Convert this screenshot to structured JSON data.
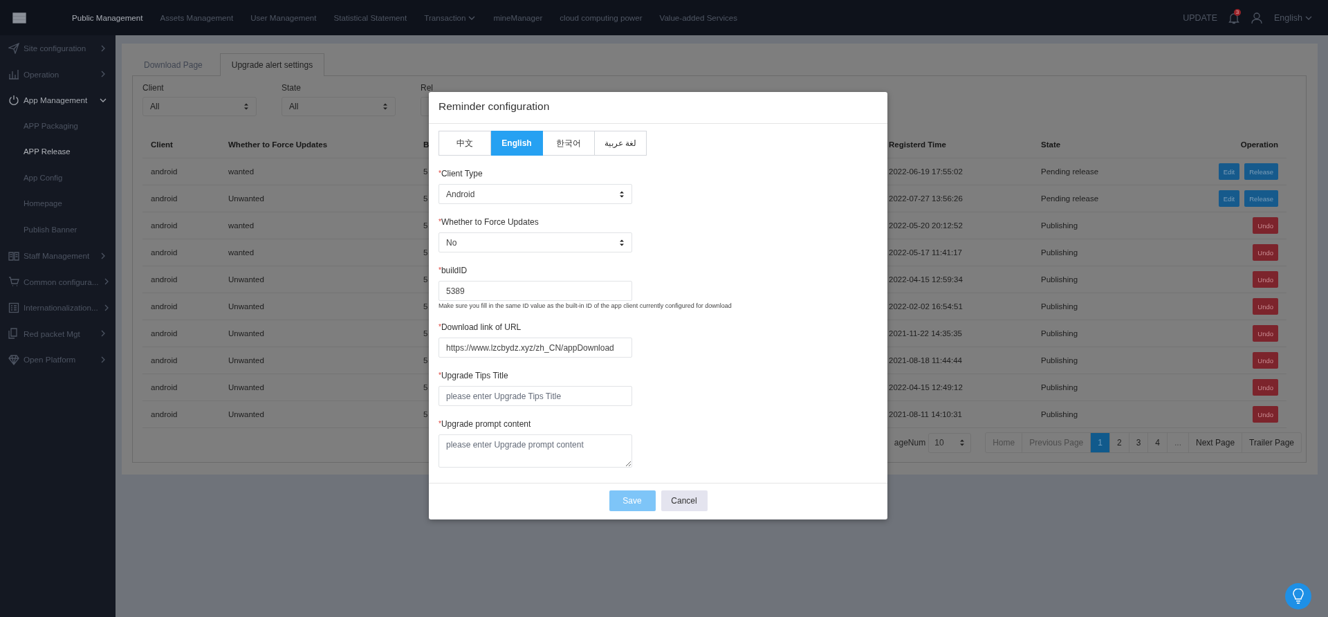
{
  "top_bar": {
    "nav": [
      {
        "label": "Public Management",
        "selected": true,
        "dropdown": false
      },
      {
        "label": "Assets Management",
        "selected": false,
        "dropdown": false
      },
      {
        "label": "User Management",
        "selected": false,
        "dropdown": false
      },
      {
        "label": "Statistical Statement",
        "selected": false,
        "dropdown": false
      },
      {
        "label": "Transaction",
        "selected": false,
        "dropdown": true
      },
      {
        "label": "mineManager",
        "selected": false,
        "dropdown": false
      },
      {
        "label": "cloud computing power",
        "selected": false,
        "dropdown": false
      },
      {
        "label": "Value-added Services",
        "selected": false,
        "dropdown": false
      }
    ],
    "update": "UPDATE",
    "notifications": "3",
    "language": "English"
  },
  "sidebar": {
    "items": [
      {
        "label": "Site configuration",
        "expanded": false
      },
      {
        "label": "Operation",
        "expanded": false
      },
      {
        "label": "App Management",
        "expanded": true,
        "children": [
          {
            "label": "APP Packaging",
            "selected": false
          },
          {
            "label": "APP Release",
            "selected": true
          },
          {
            "label": "App Config",
            "selected": false
          },
          {
            "label": "Homepage",
            "selected": false
          },
          {
            "label": "Publish Banner",
            "selected": false
          }
        ]
      },
      {
        "label": "Staff Management",
        "expanded": false
      },
      {
        "label": "Common configura...",
        "expanded": false
      },
      {
        "label": "Internationalization...",
        "expanded": false
      },
      {
        "label": "Red packet Mgt",
        "expanded": false
      },
      {
        "label": "Open Platform",
        "expanded": false
      }
    ]
  },
  "page_tabs": [
    {
      "label": "Download Page",
      "selected": false
    },
    {
      "label": "Upgrade alert settings",
      "selected": true
    }
  ],
  "filters": [
    {
      "label": "Client",
      "value": "All"
    },
    {
      "label": "State",
      "value": "All"
    },
    {
      "label": "Rel"
    }
  ],
  "table": {
    "columns": [
      "Client",
      "Whether to Force Updates",
      "B",
      "Registerd Time",
      "State",
      "Operation"
    ],
    "rows": [
      {
        "cells": [
          "android",
          "wanted",
          "5",
          "2022-06-19 17:55:02",
          "Pending release"
        ],
        "actions": [
          {
            "label": "Edit",
            "kind": "primary"
          },
          {
            "label": "Release",
            "kind": "primary"
          }
        ]
      },
      {
        "cells": [
          "android",
          "Unwanted",
          "5",
          "2022-07-27 13:56:26",
          "Pending release"
        ],
        "actions": [
          {
            "label": "Edit",
            "kind": "primary"
          },
          {
            "label": "Release",
            "kind": "primary"
          }
        ]
      },
      {
        "cells": [
          "android",
          "wanted",
          "5",
          "2022-05-20 20:12:52",
          "Publishing"
        ],
        "actions": [
          {
            "label": "Undo",
            "kind": "danger"
          }
        ]
      },
      {
        "cells": [
          "android",
          "wanted",
          "5",
          "2022-05-17 11:41:17",
          "Publishing"
        ],
        "actions": [
          {
            "label": "Undo",
            "kind": "danger"
          }
        ]
      },
      {
        "cells": [
          "android",
          "Unwanted",
          "5",
          "2022-04-15 12:59:34",
          "Publishing"
        ],
        "actions": [
          {
            "label": "Undo",
            "kind": "danger"
          }
        ]
      },
      {
        "cells": [
          "android",
          "Unwanted",
          "5",
          "2022-02-02 16:54:51",
          "Publishing"
        ],
        "actions": [
          {
            "label": "Undo",
            "kind": "danger"
          }
        ]
      },
      {
        "cells": [
          "android",
          "Unwanted",
          "5",
          "2021-11-22 14:35:35",
          "Publishing"
        ],
        "actions": [
          {
            "label": "Undo",
            "kind": "danger"
          }
        ]
      },
      {
        "cells": [
          "android",
          "Unwanted",
          "5",
          "2021-08-18 11:44:44",
          "Publishing"
        ],
        "actions": [
          {
            "label": "Undo",
            "kind": "danger"
          }
        ]
      },
      {
        "cells": [
          "android",
          "Unwanted",
          "5",
          "2022-04-15 12:49:12",
          "Publishing"
        ],
        "actions": [
          {
            "label": "Undo",
            "kind": "danger"
          }
        ]
      },
      {
        "cells": [
          "android",
          "Unwanted",
          "5",
          "2021-08-11 14:10:31",
          "Publishing"
        ],
        "actions": [
          {
            "label": "Undo",
            "kind": "danger"
          }
        ]
      }
    ]
  },
  "pagination": {
    "page_size_label": "ageNum",
    "page_size": "10",
    "pages": [
      {
        "label": "Home",
        "selected": false,
        "disabled": true
      },
      {
        "label": "Previous Page",
        "selected": false,
        "disabled": true
      },
      {
        "label": "1",
        "selected": true,
        "disabled": false
      },
      {
        "label": "2",
        "selected": false,
        "disabled": false
      },
      {
        "label": "3",
        "selected": false,
        "disabled": false
      },
      {
        "label": "4",
        "selected": false,
        "disabled": false
      },
      {
        "label": "...",
        "selected": false,
        "disabled": true
      },
      {
        "label": "Next Page",
        "selected": false,
        "disabled": false
      },
      {
        "label": "Trailer Page",
        "selected": false,
        "disabled": false
      }
    ]
  },
  "modal": {
    "title": "Reminder configuration",
    "lang_tabs": [
      {
        "label": "中文",
        "selected": false
      },
      {
        "label": "English",
        "selected": true
      },
      {
        "label": "한국어",
        "selected": false
      },
      {
        "label": "لغة عربية",
        "selected": false
      }
    ],
    "fields": [
      {
        "required_mark": "*",
        "label": "Client Type",
        "kind": "select",
        "value": "Android"
      },
      {
        "required_mark": "*",
        "label": "Whether to Force Updates",
        "kind": "select",
        "value": "No"
      },
      {
        "required_mark": "*",
        "label": "buildID",
        "kind": "input",
        "value": "5389",
        "hint": "Make sure you fill in the same ID value as the built-in ID of the app client currently configured for download"
      },
      {
        "required_mark": "*",
        "label": "Download link of URL",
        "kind": "input",
        "value": "https://www.lzcbydz.xyz/zh_CN/appDownload"
      },
      {
        "required_mark": "*",
        "label": "Upgrade Tips Title",
        "kind": "input",
        "placeholder": "please enter Upgrade Tips Title"
      },
      {
        "required_mark": "*",
        "label": "Upgrade prompt content",
        "kind": "textarea",
        "placeholder": "please enter Upgrade prompt content"
      }
    ],
    "buttons": [
      {
        "label": "Save",
        "kind": "primary",
        "disabled": true
      },
      {
        "label": "Cancel",
        "kind": "default",
        "disabled": false
      }
    ]
  }
}
